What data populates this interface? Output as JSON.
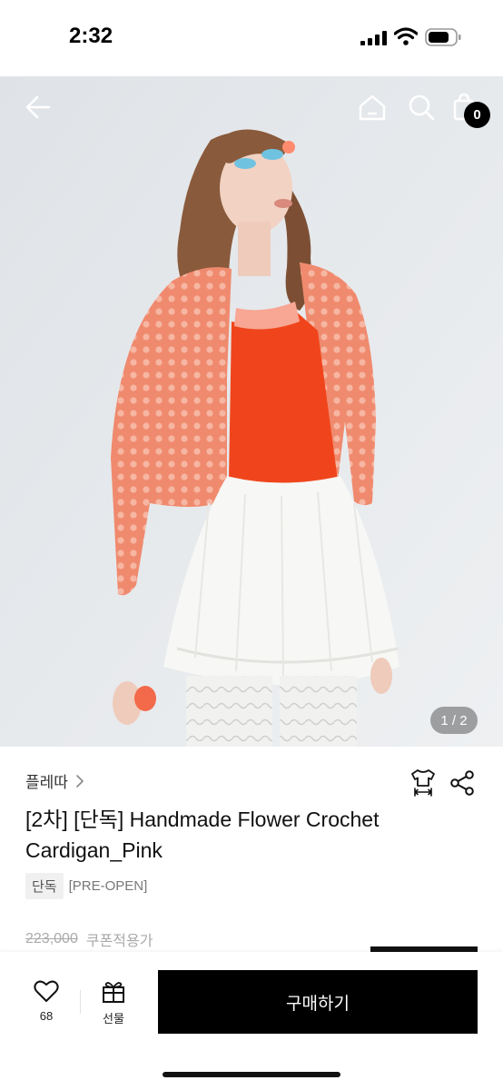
{
  "status_bar": {
    "time": "2:32"
  },
  "header": {
    "bag_count": "0"
  },
  "gallery": {
    "counter": "1 / 2"
  },
  "product": {
    "brand": "플레따",
    "title": "[2차] [단독] Handmade Flower Crochet Cardigan_Pink",
    "tag_exclusive": "단독",
    "tag_preopen": "[PRE-OPEN]",
    "price_original": "223,000",
    "coupon_label": "쿠폰적용가"
  },
  "bottom_bar": {
    "like_count": "68",
    "gift_label": "선물",
    "buy_label": "구매하기"
  },
  "icons": {
    "back": "arrow-left-icon",
    "home": "home-icon",
    "search": "search-icon",
    "bag": "shopping-bag-icon",
    "size": "size-guide-icon",
    "share": "share-icon",
    "like": "heart-icon",
    "gift": "gift-icon"
  },
  "colors": {
    "cardigan": "#f08a6e",
    "top": "#f0451c",
    "skirt": "#f7f7f5",
    "background": "#e8ebee"
  }
}
